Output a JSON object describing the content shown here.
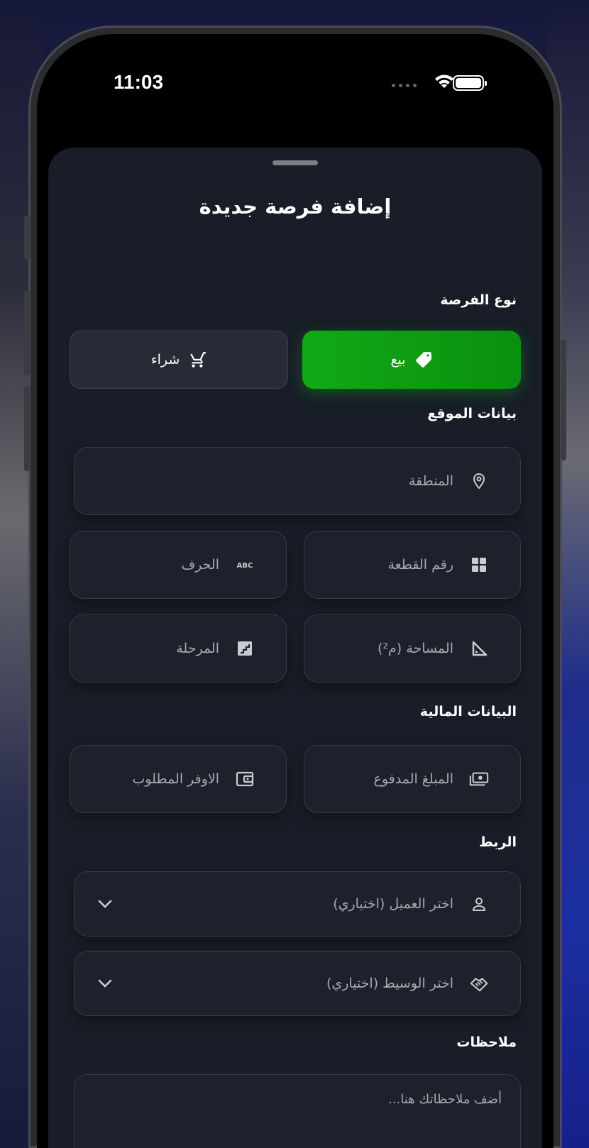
{
  "status_bar": {
    "time": "11:03"
  },
  "sheet": {
    "title": "إضافة فرصة جديدة",
    "opportunity_type": {
      "label": "نوع الفرصة",
      "sell_label": "بيع",
      "buy_label": "شراء",
      "selected": "بيع"
    },
    "location": {
      "label": "بيانات الموقع",
      "area_placeholder": "المنطقة",
      "plot_number_placeholder": "رقم القطعة",
      "letter_placeholder": "الحرف",
      "space_placeholder": "المساحة (م²)",
      "phase_placeholder": "المرحلة"
    },
    "financial": {
      "label": "البيانات المالية",
      "paid_amount_placeholder": "المبلغ المدفوع",
      "required_savings_placeholder": "الاوفر المطلوب"
    },
    "linking": {
      "label": "الربط",
      "client_placeholder": "اختر العميل (اختياري)",
      "broker_placeholder": "اختر الوسيط (اختياري)"
    },
    "notes": {
      "label": "ملاحظات",
      "placeholder": "أضف ملاحظاتك هنا..."
    }
  },
  "colors": {
    "accent_green": "#12a915",
    "sheet_bg": "#181d27",
    "field_bg": "#1c212c"
  }
}
